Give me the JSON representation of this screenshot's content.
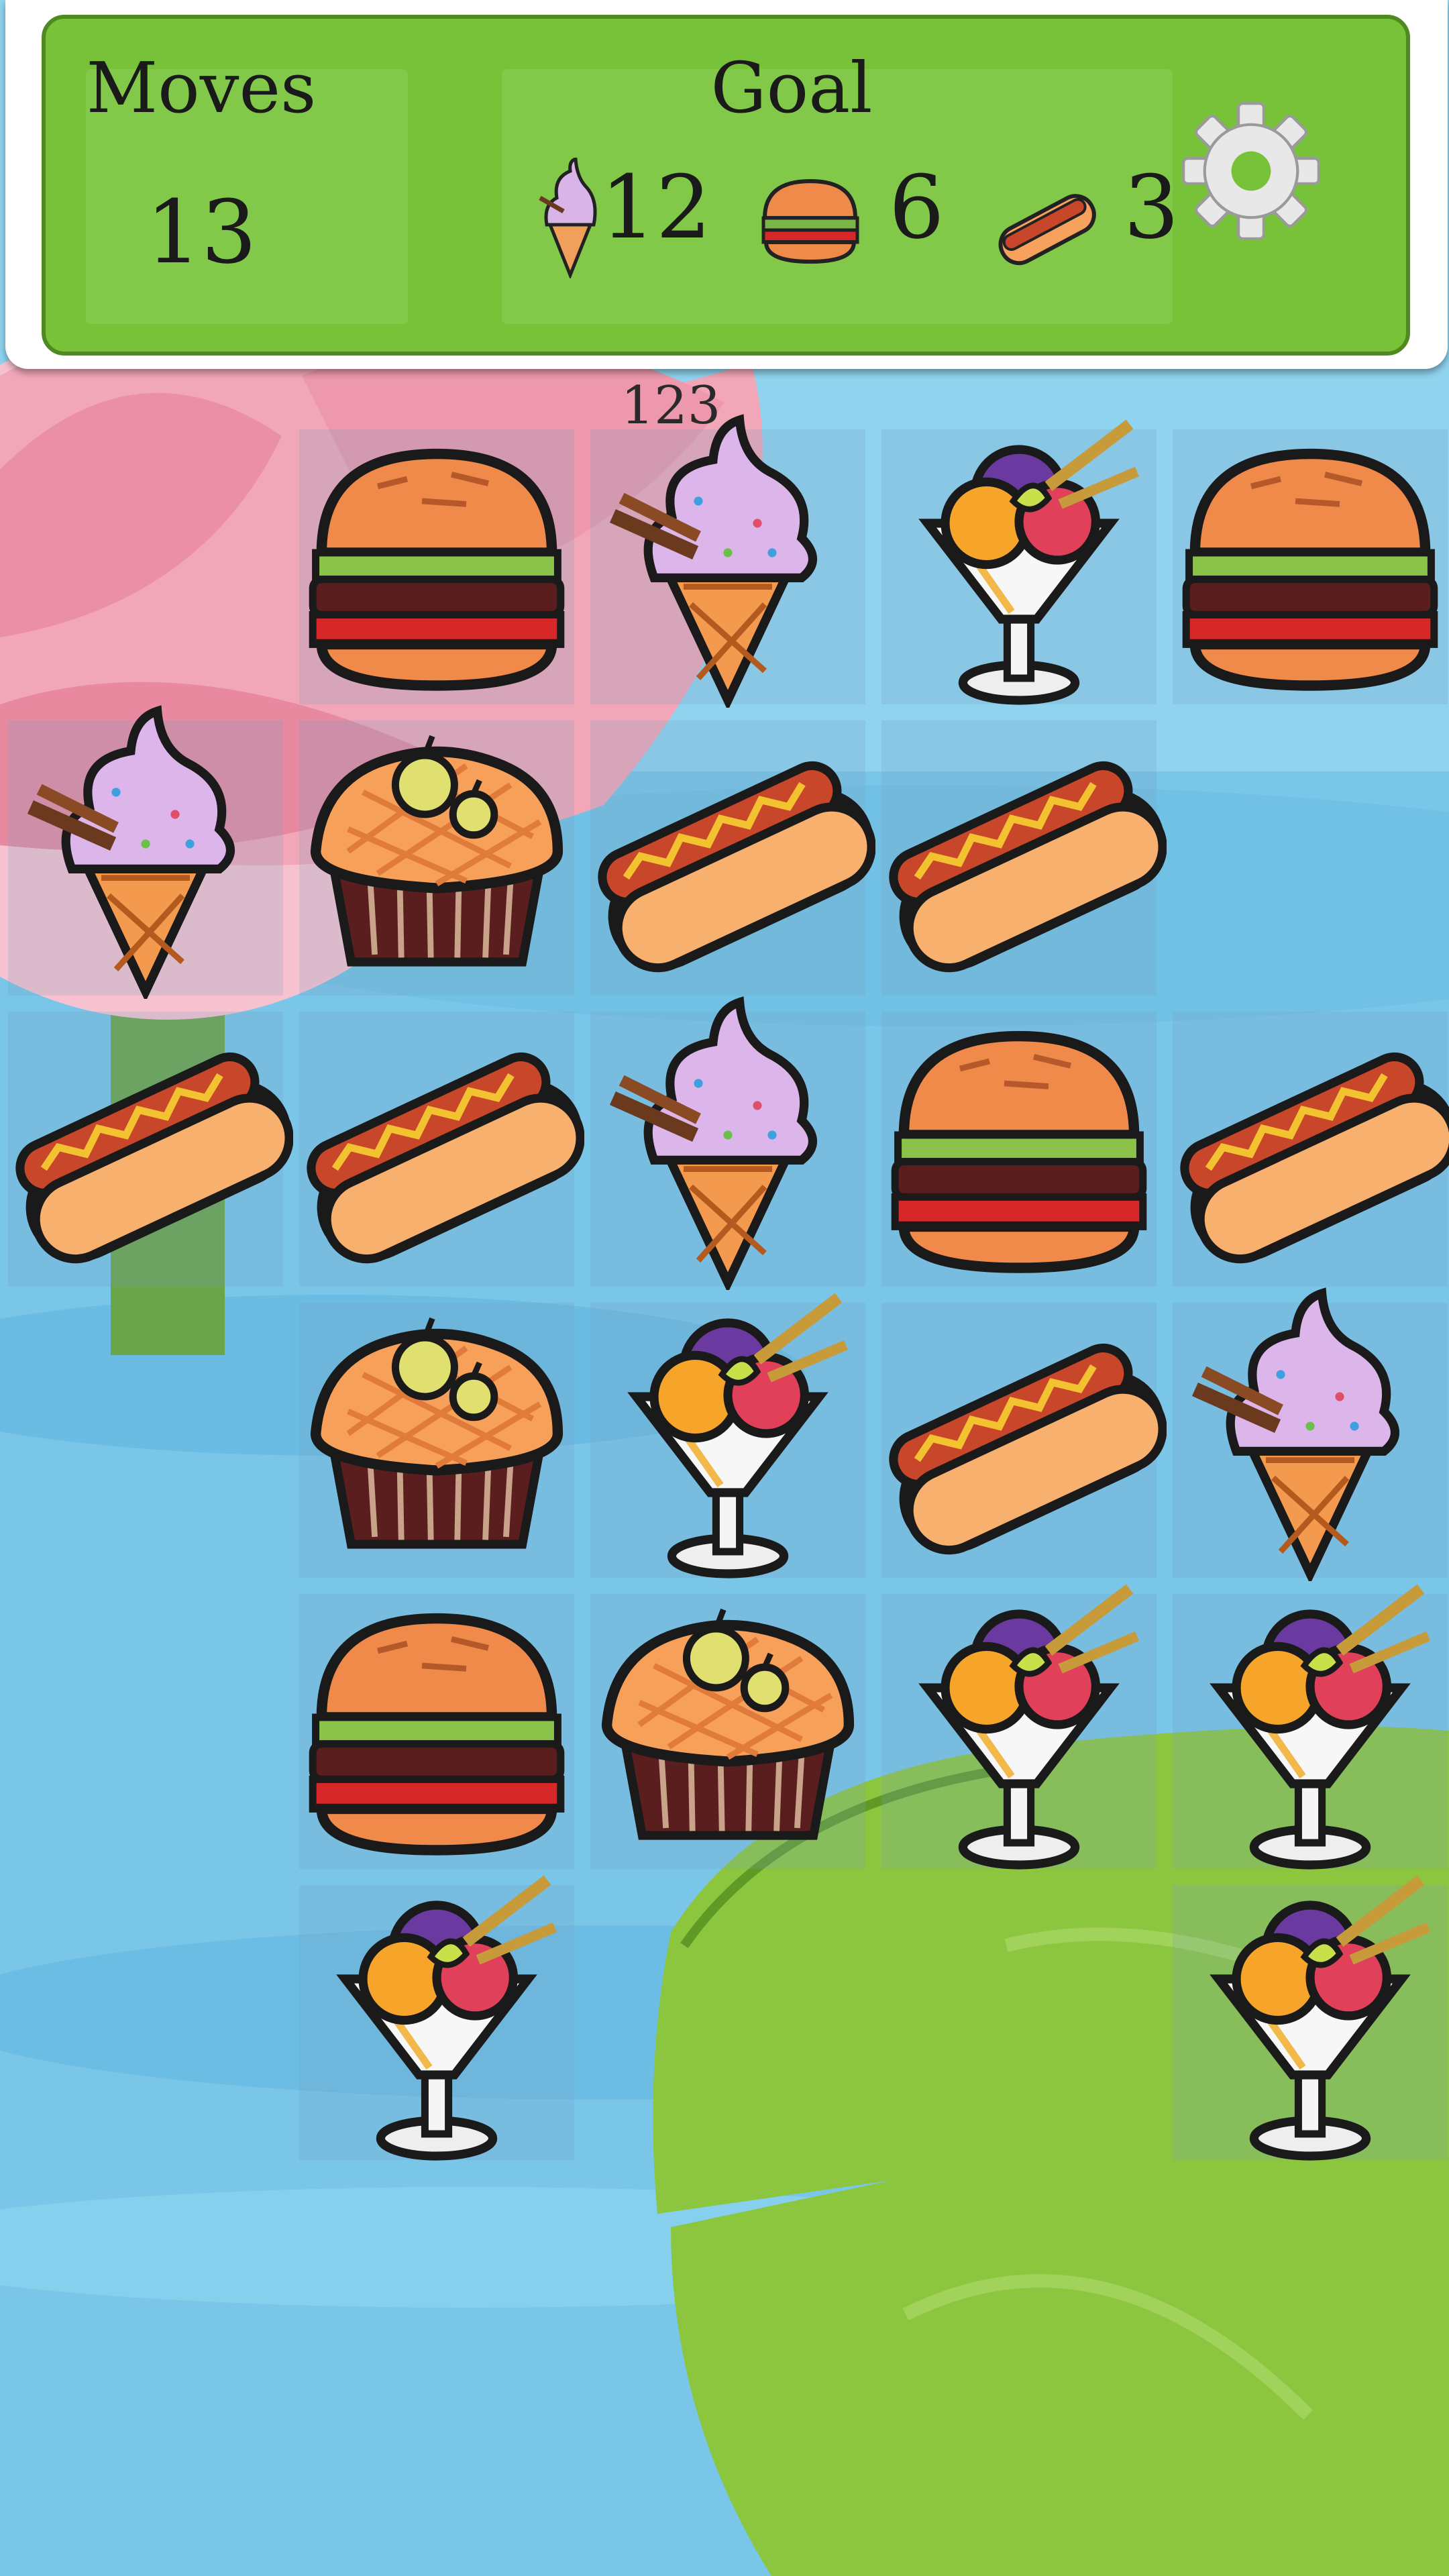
{
  "header": {
    "moves_label": "Moves",
    "moves_value": "13",
    "goal_label": "Goal",
    "goals": [
      {
        "item": "ice-cream-cone",
        "count": "12"
      },
      {
        "item": "burger",
        "count": "6"
      },
      {
        "item": "hot-dog",
        "count": "3"
      }
    ],
    "settings_icon": "gear-icon"
  },
  "board": {
    "floating_score": "123",
    "columns": 5,
    "rows": 6,
    "grid": [
      [
        null,
        "burger",
        "ice-cream-cone",
        "sundae",
        "burger"
      ],
      [
        "ice-cream-cone",
        "apple-pie",
        "hot-dog",
        "hot-dog",
        null
      ],
      [
        "hot-dog",
        "hot-dog",
        "ice-cream-cone",
        "burger",
        "hot-dog"
      ],
      [
        null,
        "apple-pie",
        "sundae",
        "hot-dog",
        "ice-cream-cone"
      ],
      [
        null,
        "burger",
        "apple-pie",
        "sundae",
        "sundae"
      ],
      [
        null,
        "sundae",
        null,
        null,
        "sundae"
      ]
    ]
  },
  "colors": {
    "panel_green": "#78c23a",
    "panel_border": "#4f8a20",
    "water": "#8fd3ef",
    "lily_pad": "#8cc63f",
    "lotus": "#f2a7b8"
  }
}
